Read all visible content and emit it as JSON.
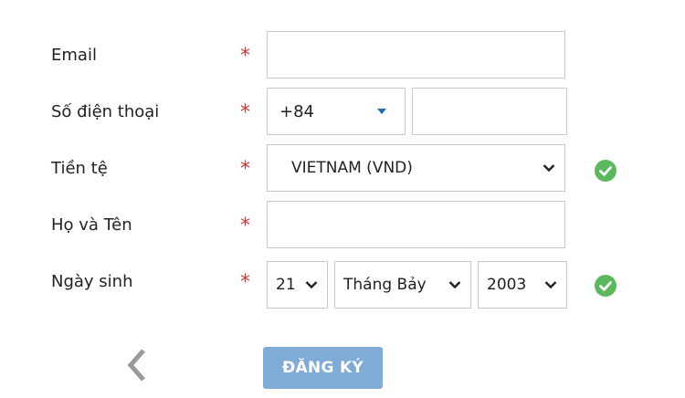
{
  "form": {
    "email": {
      "label": "Email",
      "required": "*",
      "value": ""
    },
    "phone": {
      "label": "Số điện thoại",
      "required": "*",
      "country_code": "+84",
      "value": ""
    },
    "currency": {
      "label": "Tiền tệ",
      "required": "*",
      "selected": "VIETNAM (VND)"
    },
    "full_name": {
      "label": "Họ và Tên",
      "required": "*",
      "value": ""
    },
    "birthday": {
      "label": "Ngày sinh",
      "required": "*",
      "day": "21",
      "month": "Tháng Bảy",
      "year": "2003"
    }
  },
  "actions": {
    "submit_label": "ĐĂNG KÝ"
  },
  "icons": {
    "valid": "check-circle-icon",
    "back": "chevron-left-icon"
  },
  "colors": {
    "required": "#d23a36",
    "valid": "#5cb85c",
    "button": "#7fabd7",
    "caret": "#1d6fb8"
  }
}
